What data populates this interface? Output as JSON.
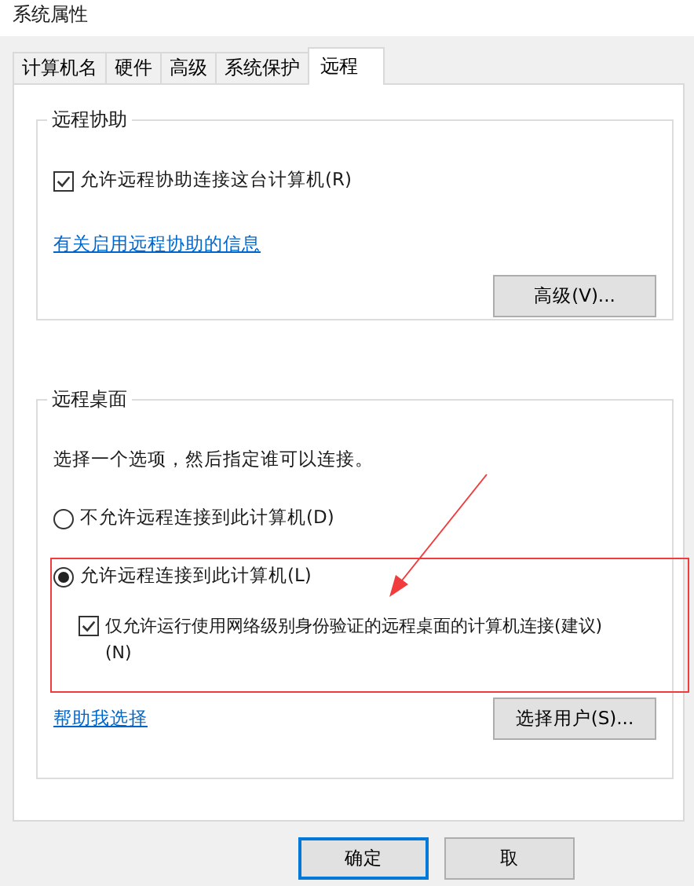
{
  "window": {
    "title": "系统属性"
  },
  "tabs": [
    {
      "label": "计算机名",
      "selected": false
    },
    {
      "label": "硬件",
      "selected": false
    },
    {
      "label": "高级",
      "selected": false
    },
    {
      "label": "系统保护",
      "selected": false
    },
    {
      "label": "远程",
      "selected": true
    }
  ],
  "remote_assistance": {
    "title": "远程协助",
    "checkbox": {
      "label": "允许远程协助连接这台计算机(R)",
      "checked": true
    },
    "link": "有关启用远程协助的信息",
    "button": "高级(V)..."
  },
  "remote_desktop": {
    "title": "远程桌面",
    "instruction": "选择一个选项，然后指定谁可以连接。",
    "options": [
      {
        "kind": "radio",
        "label": "不允许远程连接到此计算机(D)",
        "selected": false
      },
      {
        "kind": "radio",
        "label": "允许远程连接到此计算机(L)",
        "selected": true
      },
      {
        "kind": "checkbox",
        "label": "仅允许运行使用网络级别身份验证的远程桌面的计算机连接(建议)(N)",
        "checked": true
      }
    ],
    "link": "帮助我选择",
    "button": "选择用户(S)..."
  },
  "buttons": [
    {
      "label": "确定",
      "default": true
    },
    {
      "label": "取",
      "default": false
    }
  ]
}
